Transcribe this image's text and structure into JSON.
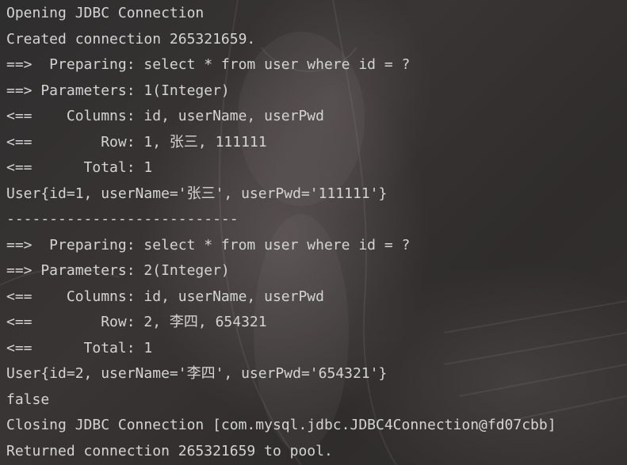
{
  "console": {
    "lines": [
      "Opening JDBC Connection",
      "Created connection 265321659.",
      "==>  Preparing: select * from user where id = ?",
      "==> Parameters: 1(Integer)",
      "<==    Columns: id, userName, userPwd",
      "<==        Row: 1, 张三, 111111",
      "<==      Total: 1",
      "User{id=1, userName='张三', userPwd='111111'}",
      "---------------------------",
      "==>  Preparing: select * from user where id = ?",
      "==> Parameters: 2(Integer)",
      "<==    Columns: id, userName, userPwd",
      "<==        Row: 2, 李四, 654321",
      "<==      Total: 1",
      "User{id=2, userName='李四', userPwd='654321'}",
      "false",
      "Closing JDBC Connection [com.mysql.jdbc.JDBC4Connection@fd07cbb]",
      "Returned connection 265321659 to pool."
    ]
  },
  "background": {
    "color": "#2b2b2b",
    "text_color": "#d4d4d4"
  }
}
